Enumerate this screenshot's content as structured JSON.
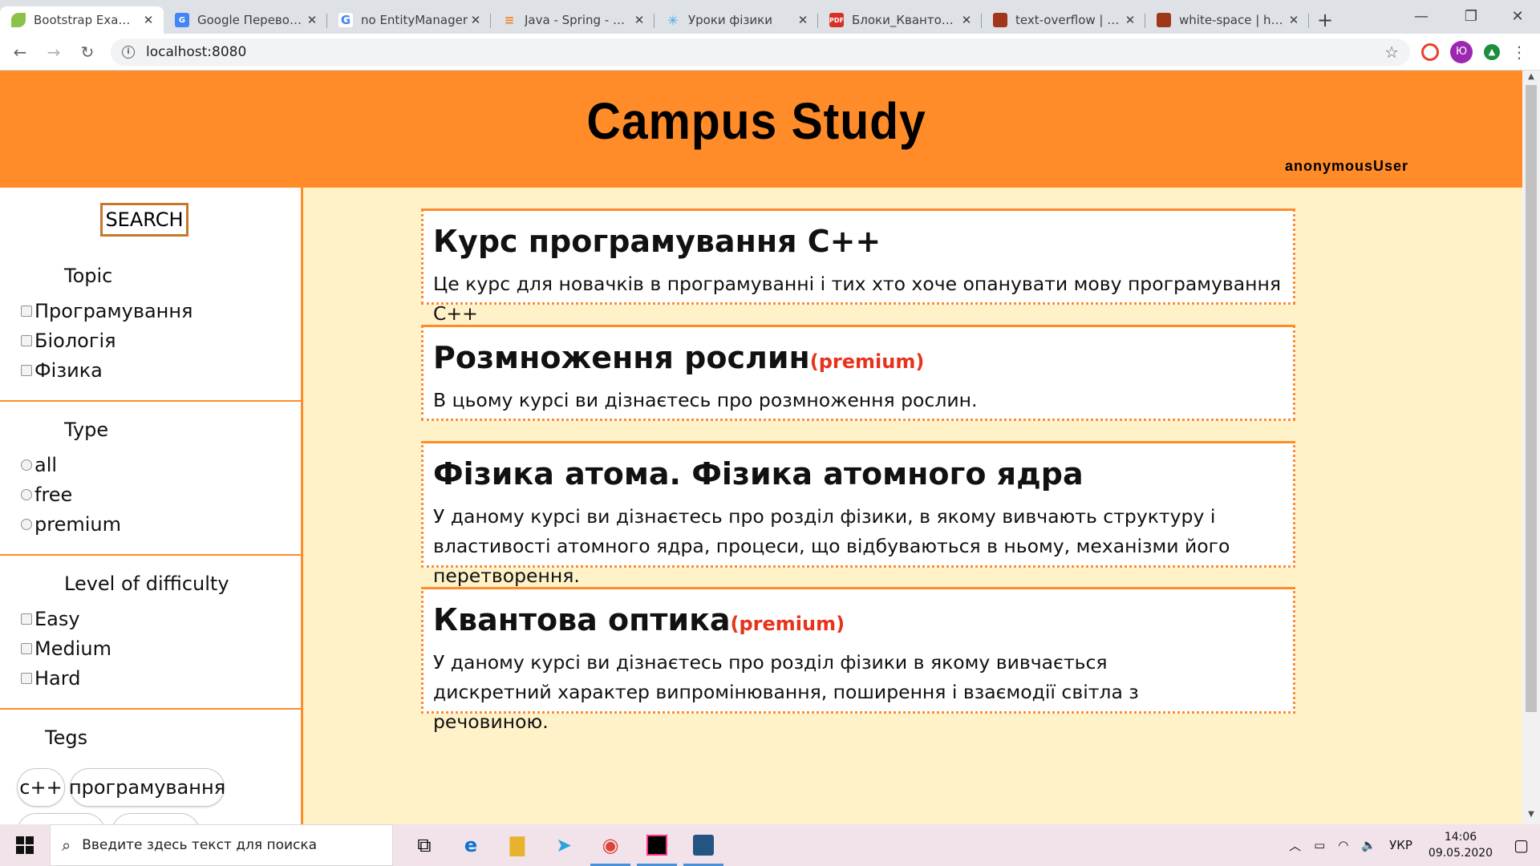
{
  "browser": {
    "tabs": [
      {
        "title": "Bootstrap Example",
        "favicon": "leaf-icon",
        "active": true
      },
      {
        "title": "Google Переводчик",
        "favicon": "google-translate-icon"
      },
      {
        "title": "no EntityManager",
        "favicon": "google-icon"
      },
      {
        "title": "Java - Spring - Нет",
        "favicon": "stackoverflow-icon"
      },
      {
        "title": "Уроки фізики",
        "favicon": "atom-icon"
      },
      {
        "title": "Блоки_Квантова т",
        "favicon": "pdf-icon"
      },
      {
        "title": "text-overflow | htm",
        "favicon": "htmlbook-icon"
      },
      {
        "title": "white-space | html",
        "favicon": "htmlbook-icon"
      }
    ],
    "address": "localhost:8080",
    "profile_initial": "Ю"
  },
  "header": {
    "title": "Campus Study",
    "user": "anonymousUser"
  },
  "sidebar": {
    "search_label": "SEARCH",
    "topic": {
      "title": "Topic",
      "options": [
        "Програмування",
        "Біологія",
        "Фізика"
      ]
    },
    "type": {
      "title": "Type",
      "options": [
        "all",
        "free",
        "premium"
      ]
    },
    "difficulty": {
      "title": "Level of difficulty",
      "options": [
        "Easy",
        "Medium",
        "Hard"
      ]
    },
    "tags": {
      "title": "Tegs",
      "items": [
        "c++",
        "програмування"
      ]
    }
  },
  "courses": [
    {
      "title": "Курс програмування С++",
      "premium": "",
      "description": "Це курс для новачків в програмуванні і тих хто хоче опанувати мову програмування С++"
    },
    {
      "title": "Розмноження рослин",
      "premium": "(premium)",
      "description": "В цьому курсі ви дізнаєтесь про розмноження рослин."
    },
    {
      "title": "Фізика атома. Фізика атомного ядра",
      "premium": "",
      "description": "У даному курсі ви дізнаєтесь про розділ фізики, в якому вивчають структуру і властивості атомного ядра, процеси, що відбуваються в ньому, механізми його перетворення."
    },
    {
      "title": "Квантова оптика",
      "premium": "(premium)",
      "description": "У даному курсі ви дізнаєтесь про розділ фізики в якому вивчається дискретний характер випромінювання, поширення і взаємодії світла з речовиною."
    }
  ],
  "taskbar": {
    "search_placeholder": "Введите здесь текст для поиска",
    "language": "УКР",
    "time": "14:06",
    "date": "09.05.2020"
  },
  "colors": {
    "header": "#ff8c29",
    "page_bg": "#fff2c8",
    "premium": "#e8331c"
  }
}
